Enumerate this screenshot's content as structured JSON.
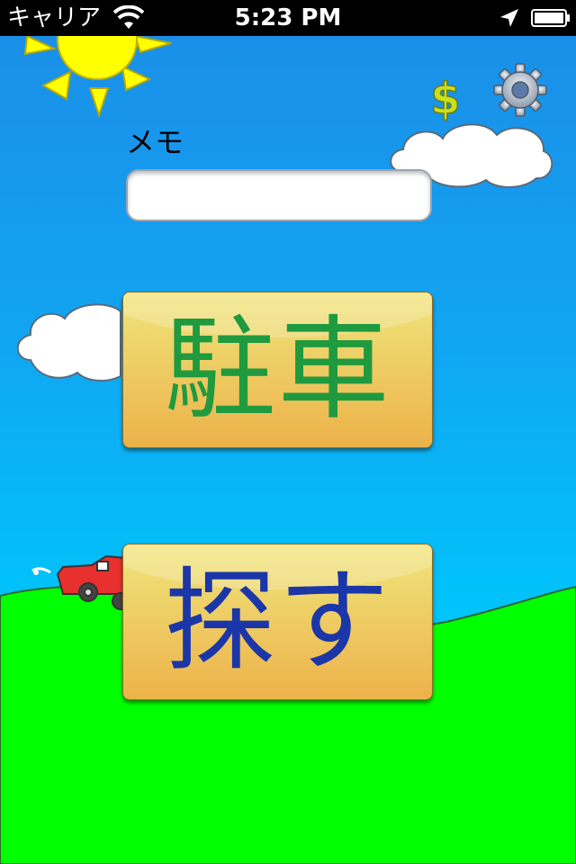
{
  "status_bar": {
    "carrier": "キャリア",
    "time": "5:23 PM",
    "icons": [
      "wifi-icon",
      "location-arrow-icon",
      "battery-icon"
    ]
  },
  "toolbar": {
    "purchase_icon": "dollar-icon",
    "settings_icon": "gear-icon"
  },
  "memo": {
    "label": "メモ",
    "value": "",
    "placeholder": ""
  },
  "buttons": {
    "park_label": "駐車",
    "search_label": "探す"
  },
  "colors": {
    "sky": "#12a4f1",
    "grass": "#00ff00",
    "button_gradient_top": "#f1e57c",
    "button_gradient_bottom": "#edb24a",
    "park_text": "#1f9a3f",
    "search_text": "#1a36a8"
  }
}
